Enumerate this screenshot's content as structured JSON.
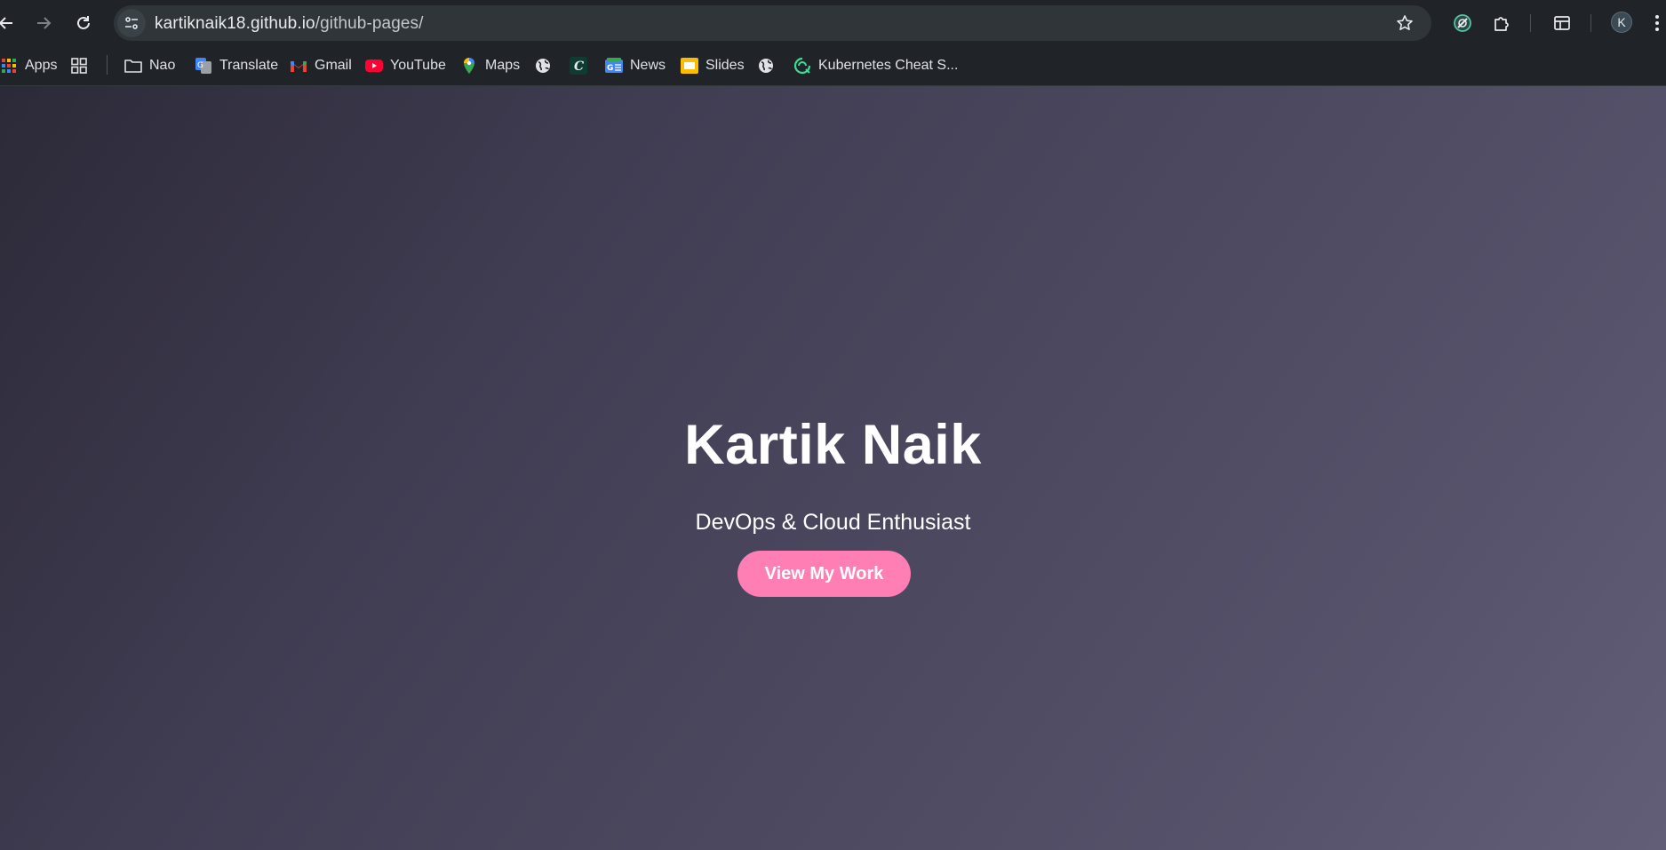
{
  "browser": {
    "url_host": "kartiknaik18.github.io",
    "url_path": "/github-pages/",
    "profile_initial": "K",
    "icons": {
      "back": "back-arrow-icon",
      "forward": "forward-arrow-icon",
      "reload": "reload-icon",
      "site_info": "site-settings-icon",
      "bookmark": "star-icon",
      "extension_a": "extension-icon",
      "extensions": "puzzle-icon",
      "side_panel": "side-panel-icon",
      "menu": "kebab-menu-icon"
    }
  },
  "bookmarks": [
    {
      "label": "Apps",
      "icon": "apps-grid-icon"
    },
    {
      "label": "",
      "icon": "tab-groups-icon"
    },
    {
      "label": "Nao",
      "icon": "folder-icon"
    },
    {
      "label": "Translate",
      "icon": "google-translate-icon"
    },
    {
      "label": "Gmail",
      "icon": "gmail-icon"
    },
    {
      "label": "YouTube",
      "icon": "youtube-icon"
    },
    {
      "label": "Maps",
      "icon": "maps-pin-icon"
    },
    {
      "label": "",
      "icon": "globe-icon"
    },
    {
      "label": "",
      "icon": "c-logo-icon"
    },
    {
      "label": "News",
      "icon": "google-news-icon"
    },
    {
      "label": "Slides",
      "icon": "slides-icon"
    },
    {
      "label": "",
      "icon": "globe-icon"
    },
    {
      "label": "Kubernetes Cheat S...",
      "icon": "kubernetes-icon"
    }
  ],
  "hero": {
    "title": "Kartik Naik",
    "subtitle": "DevOps & Cloud Enthusiast",
    "cta_label": "View My Work"
  },
  "colors": {
    "accent": "#ff7eb3",
    "chrome_bg": "#202428",
    "omnibox_bg": "#2f3539"
  }
}
